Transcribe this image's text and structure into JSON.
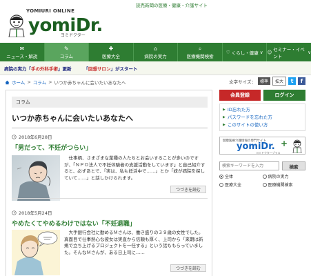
{
  "header": {
    "tagline": "読売新聞の医療・健康・介護サイト",
    "brand_small": "YOMIURI ONLINE",
    "logo_text": "yomiDr.",
    "logo_kana": "ヨミドクター"
  },
  "nav": {
    "items": [
      {
        "icon": "news-icon",
        "glyph": "✉",
        "label": "ニュース・解説"
      },
      {
        "icon": "column-icon",
        "glyph": "✎",
        "label": "コラム"
      },
      {
        "icon": "medical-icon",
        "glyph": "✚",
        "label": "医療大全"
      },
      {
        "icon": "hospital-icon",
        "glyph": "⌂",
        "label": "病院の実力"
      },
      {
        "icon": "search-icon",
        "glyph": "⌕",
        "label": "医療機関検索"
      },
      {
        "icon": "heart-icon",
        "glyph": "♡",
        "label": "くらし・健康",
        "chevron": "∨"
      },
      {
        "icon": "seminar-icon",
        "glyph": "☺",
        "label": "セミナー・イベント",
        "chevron": "∨"
      }
    ]
  },
  "newsbar": {
    "item1_prefix": "病院の実力「",
    "item1_highlight": "手の外科手術",
    "item1_suffix": "」更新",
    "item2_prefix": "「",
    "item2_highlight": "回想サロン",
    "item2_suffix": "」がスタート"
  },
  "breadcrumb": {
    "home": "ホーム",
    "sep": ">",
    "column": "コラム",
    "current": "いつか赤ちゃんに会いたいあなたへ"
  },
  "font_size": {
    "label": "文字サイズ：",
    "standard": "標準",
    "large": "拡大"
  },
  "main": {
    "category": "コラム",
    "title": "いつか赤ちゃんに会いたいあなたへ",
    "articles": [
      {
        "date": "2018年6月28日",
        "title": "「男だって、不妊がつらい」",
        "body": "　仕事柄、さまざまな業種の人たちとお会いすることが多いのですが、「ＮＰＯ法人で不妊体験者の支援活動をしています」と自己紹介すると、必ずあとで、「実は、私も妊活中で……」とか「妹が病院を探していて……」と話しかけられます。",
        "read_more": "つづきを読む"
      },
      {
        "date": "2018年5月24日",
        "title": "やめたくてやめるわけではない「不妊退職」",
        "body": "　大手銀行会社に勤めるＭさんは、働き盛りの３９歳の女性でした。真面目で仕事熱心な彼女は実直から信頼も厚く、上司から「来期は新規で立ち上げるプロジェクトを一任する」という話ももらっていました。そんなＭさんが、ある日上司に……",
        "read_more": "つづきを読む"
      }
    ]
  },
  "sidebar": {
    "join_label": "会員登録",
    "login_label": "ログイン",
    "links": [
      "ID忘れた方",
      "パスワードを忘れた方",
      "このサイトの使い方"
    ],
    "banner_small": "健康医療介護情報の専門サイト",
    "banner_logo": "yomiDr.",
    "banner_plus": "+",
    "banner_kana": "ヨミドクタープラス",
    "search_placeholder": "検索キーワードを入力",
    "search_button": "検索",
    "search_options": [
      "全体",
      "病院の実力",
      "医療大全",
      "医療機関検索"
    ]
  },
  "colors": {
    "brand_green": "#2e7d32",
    "join_red": "#c62828",
    "link_blue": "#1565c0"
  }
}
